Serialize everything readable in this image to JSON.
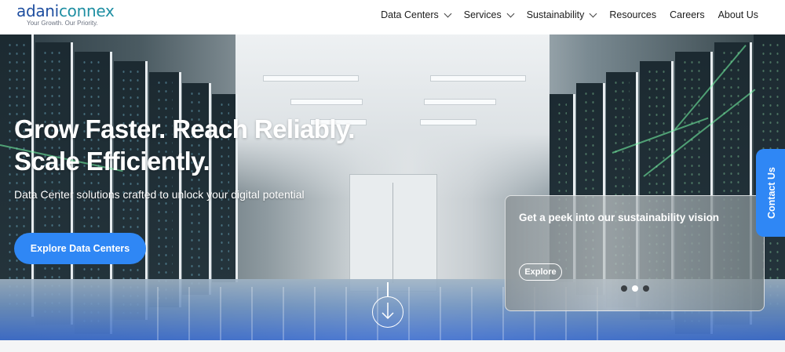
{
  "header": {
    "logo": {
      "part1": "adani",
      "part2": "connex",
      "tagline": "Your Growth. Our Priority."
    },
    "nav": [
      {
        "label": "Data Centers",
        "has_dropdown": true
      },
      {
        "label": "Services",
        "has_dropdown": true
      },
      {
        "label": "Sustainability",
        "has_dropdown": true
      },
      {
        "label": "Resources",
        "has_dropdown": false
      },
      {
        "label": "Careers",
        "has_dropdown": false
      },
      {
        "label": "About Us",
        "has_dropdown": false
      }
    ]
  },
  "hero": {
    "title_line1": "Grow Faster. Reach Reliably.",
    "title_line2": "Scale Efficiently.",
    "subtitle": "Data Center solutions crafted to unlock your digital potential",
    "cta_label": "Explore Data Centers",
    "scroll_icon": "arrow-down-circle-icon"
  },
  "promo_card": {
    "title": "Get a peek into our sustainability vision",
    "button_label": "Explore",
    "slides_total": 3,
    "active_slide": 2
  },
  "contact_tab": {
    "label": "Contact Us"
  },
  "colors": {
    "accent": "#2f87f5",
    "logo_primary": "#1f4fa0",
    "logo_secondary": "#1f8fa3"
  }
}
